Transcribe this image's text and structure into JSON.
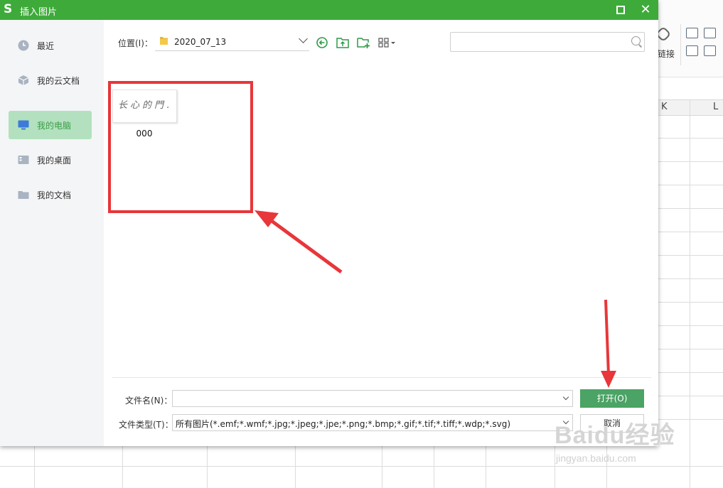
{
  "dialog": {
    "title": "插入图片",
    "app_logo_char": "S",
    "close_glyph": "✕"
  },
  "sidebar": {
    "items": [
      {
        "label": "最近",
        "icon": "clock-icon",
        "active": false
      },
      {
        "label": "我的云文档",
        "icon": "cloud-box-icon",
        "active": false
      },
      {
        "label": "我的电脑",
        "icon": "monitor-icon",
        "active": true
      },
      {
        "label": "我的桌面",
        "icon": "desktop-icon",
        "active": false
      },
      {
        "label": "我的文档",
        "icon": "folder-icon",
        "active": false
      }
    ]
  },
  "toolbar": {
    "location_label": "位置(I)：",
    "location_value": "2020_07_13",
    "buttons": [
      "back-circle-icon",
      "folder-up-icon",
      "new-folder-icon",
      "view-grid-icon"
    ]
  },
  "files": [
    {
      "name": "000",
      "thumbnail_text": "长心的門."
    }
  ],
  "bottom": {
    "filename_label": "文件名(N)：",
    "filename_value": "",
    "filetype_label": "文件类型(T)：",
    "filetype_value": "所有图片(*.emf;*.wmf;*.jpg;*.jpeg;*.jpe;*.png;*.bmp;*.gif;*.tif;*.tiff;*.wdp;*.svg)",
    "open_label": "打开(O)",
    "cancel_label": "取消"
  },
  "background": {
    "ribbon_link_label": "链接",
    "columns": [
      "K",
      "L"
    ]
  },
  "watermark": {
    "logo": "Baidu经验",
    "sub": "jingyan.baidu.com"
  },
  "colors": {
    "titlebar": "#3eaa3a",
    "open_button": "#4ba365",
    "active_sidebar": "#b3e1bf",
    "annotation_red": "#e8363a"
  }
}
